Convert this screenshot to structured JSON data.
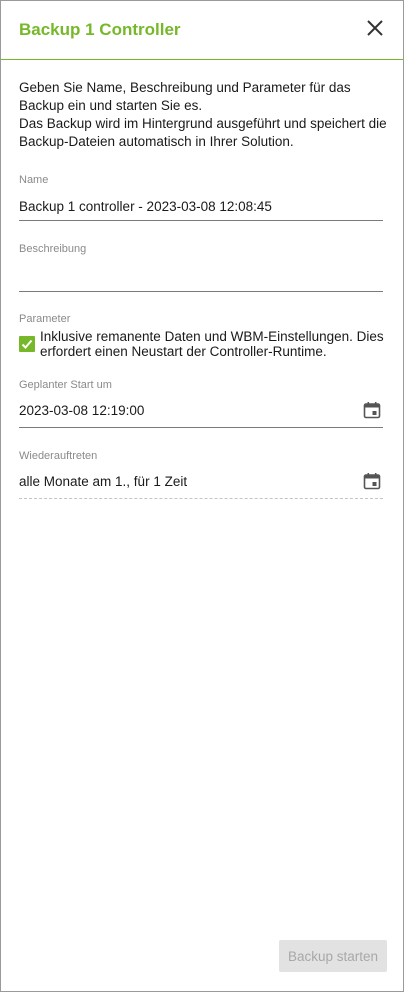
{
  "dialog": {
    "title": "Backup 1 Controller",
    "intro_line1": "Geben Sie Name, Beschreibung und Parameter für das Backup ein und starten Sie es.",
    "intro_line2": "Das Backup wird im Hintergrund ausgeführt und speichert die Backup-Dateien automatisch in Ihrer Solution."
  },
  "form": {
    "name_label": "Name",
    "name_value": "Backup 1 controller - 2023-03-08 12:08:45",
    "description_label": "Beschreibung",
    "description_value": "",
    "parameters_label": "Parameter",
    "retain_checkbox_label": "Inklusive remanente Daten und WBM-Einstellungen. Dies erfordert einen Neustart der Controller-Runtime.",
    "retain_checked": true,
    "start_label": "Geplanter Start um",
    "start_value": "2023-03-08 12:19:00",
    "recurrence_label": "Wiederauftreten",
    "recurrence_value": "alle Monate am 1., für 1 Zeit"
  },
  "actions": {
    "start_backup": "Backup starten"
  },
  "icons": {
    "close": "close-icon",
    "calendar": "calendar-icon",
    "check": "checkmark-icon"
  },
  "colors": {
    "accent": "#76b82a",
    "label": "#8a8a8a",
    "disabled_bg": "#e2e2e2",
    "disabled_text": "#a8a8a8"
  }
}
